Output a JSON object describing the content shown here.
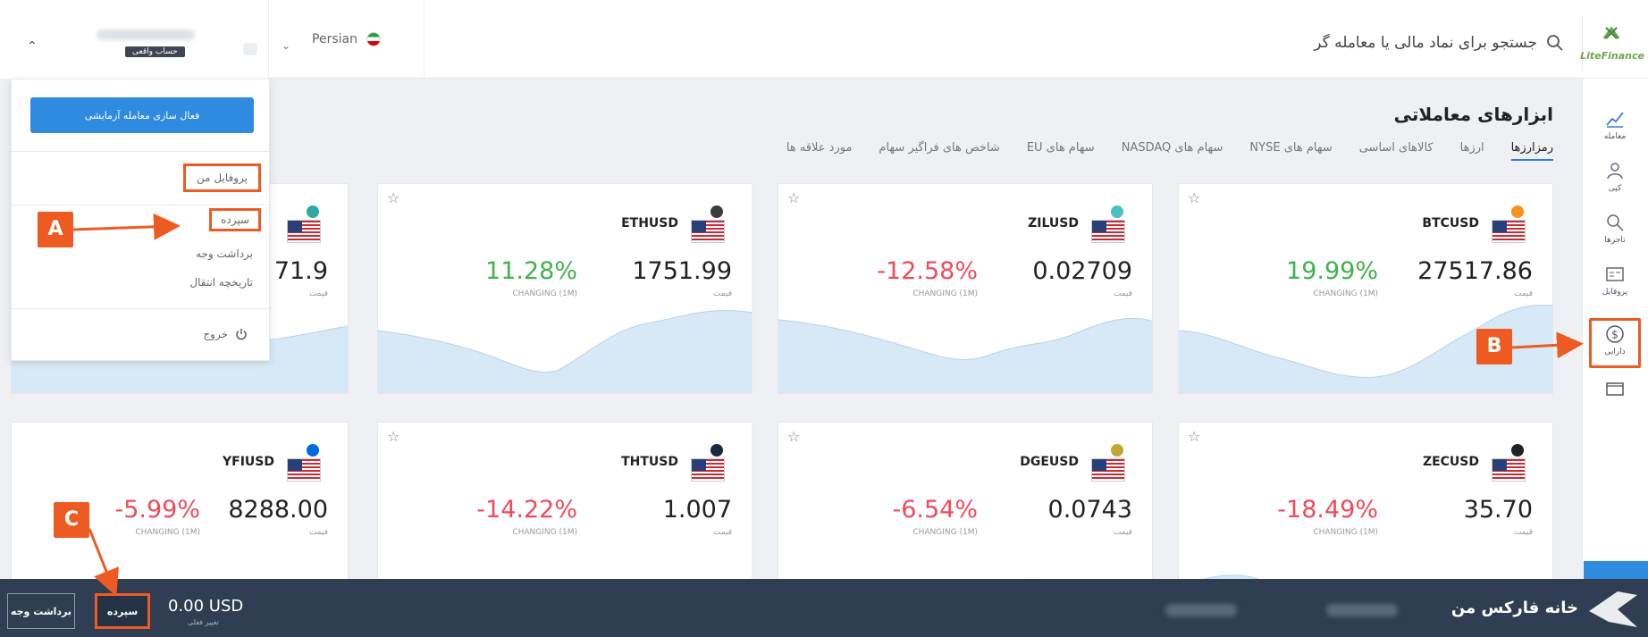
{
  "header": {
    "logo_text": "LiteFinance",
    "search_placeholder": "جستجو برای نماد مالی یا معامله گر",
    "language": "Persian",
    "account_badge": "حساب واقعی"
  },
  "sidebar": {
    "items": [
      {
        "label": "معامله",
        "icon": "chart-icon"
      },
      {
        "label": "کپی",
        "icon": "copy-trader-icon"
      },
      {
        "label": "تاجرها",
        "icon": "traders-icon"
      },
      {
        "label": "پروفایل",
        "icon": "profile-card-icon"
      },
      {
        "label": "دارایی",
        "icon": "dollar-icon"
      }
    ]
  },
  "main": {
    "title": "ابزارهای معاملاتی",
    "tabs": [
      "رمزارزها",
      "ارزها",
      "کالاهای اساسی",
      "سهام های NYSE",
      "سهام های NASDAQ",
      "سهام های EU",
      "شاخص های فراگیر سهام",
      "مورد علاقه ها"
    ]
  },
  "cards": [
    {
      "symbol": "BTCUSD",
      "price": "27517.86",
      "price_label": "قیمت",
      "change": "19.99%",
      "change_label": "CHANGING (1M)",
      "coin_color": "#f7931a"
    },
    {
      "symbol": "ZILUSD",
      "price": "0.02709",
      "price_label": "قیمت",
      "change": "-12.58%",
      "change_label": "CHANGING (1M)",
      "coin_color": "#49c1bf"
    },
    {
      "symbol": "ETHUSD",
      "price": "1751.99",
      "price_label": "قیمت",
      "change": "11.28%",
      "change_label": "CHANGING (1M)",
      "coin_color": "#3c3c3d"
    },
    {
      "symbol": "",
      "price": "71.9",
      "price_label": "قیمت",
      "change": "",
      "change_label": "",
      "coin_color": "#2ea8a0"
    },
    {
      "symbol": "ZECUSD",
      "price": "35.70",
      "price_label": "قیمت",
      "change": "-18.49%",
      "change_label": "CHANGING (1M)",
      "coin_color": "#222222"
    },
    {
      "symbol": "DGEUSD",
      "price": "0.0743",
      "price_label": "قیمت",
      "change": "-6.54%",
      "change_label": "CHANGING (1M)",
      "coin_color": "#c2a633"
    },
    {
      "symbol": "THTUSD",
      "price": "1.007",
      "price_label": "قیمت",
      "change": "-14.22%",
      "change_label": "CHANGING (1M)",
      "coin_color": "#1a2a3a"
    },
    {
      "symbol": "YFIUSD",
      "price": "8288.00",
      "price_label": "قیمت",
      "change": "-5.99%",
      "change_label": "CHANGING (1M)",
      "coin_color": "#006ae3"
    }
  ],
  "menu": {
    "demo_button": "فعال سازی معامله آزمایشی",
    "profile": "پروفایل من",
    "deposit": "سپرده",
    "withdraw": "برداشت وجه",
    "transfer_history": "تاریخچه انتقال",
    "logout": "خروج"
  },
  "bottombar": {
    "title": "خانه فارکس من",
    "balance": "0.00 USD",
    "balance_label": "تغییر فعلی",
    "deposit_button": "سپرده",
    "withdraw_button": "برداشت وجه"
  },
  "callouts": {
    "a": "A",
    "b": "B",
    "c": "C"
  }
}
